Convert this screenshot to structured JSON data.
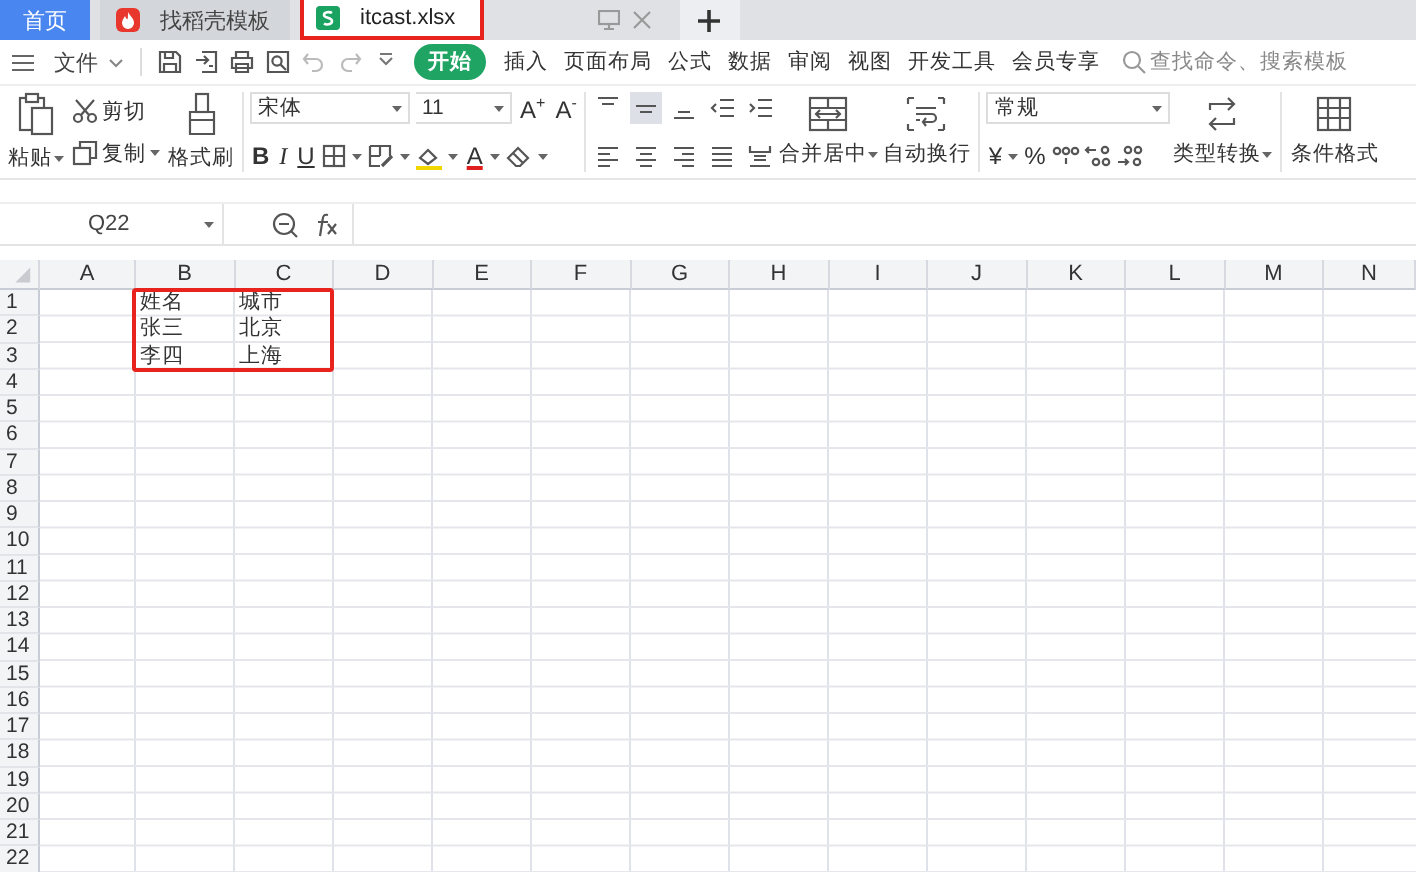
{
  "tabs": [
    {
      "label": "首页",
      "kind": "home",
      "selected": false,
      "highlighted": false
    },
    {
      "label": "找稻壳模板",
      "kind": "template",
      "selected": false,
      "highlighted": false
    },
    {
      "label": "itcast.xlsx",
      "kind": "sheet",
      "selected": true,
      "highlighted": true
    }
  ],
  "file_menu": {
    "label": "文件"
  },
  "menu_tabs": [
    {
      "label": "开始",
      "selected": true
    },
    {
      "label": "插入",
      "selected": false
    },
    {
      "label": "页面布局",
      "selected": false
    },
    {
      "label": "公式",
      "selected": false
    },
    {
      "label": "数据",
      "selected": false
    },
    {
      "label": "审阅",
      "selected": false
    },
    {
      "label": "视图",
      "selected": false
    },
    {
      "label": "开发工具",
      "selected": false
    },
    {
      "label": "会员专享",
      "selected": false
    }
  ],
  "search": {
    "placeholder": "查找命令、搜索模板"
  },
  "ribbon": {
    "clipboard": [
      {
        "kind": "paste",
        "label": "粘贴",
        "dropdown": true
      },
      {
        "kind": "cut",
        "label": "剪切",
        "dropdown": false
      },
      {
        "kind": "copy",
        "label": "复制",
        "dropdown": true
      },
      {
        "kind": "format_painter",
        "label": "格式刷",
        "dropdown": false
      }
    ],
    "font": {
      "name": "宋体",
      "size": "11",
      "size_buttons": [
        "A$^{+}$",
        "A$^{-}$"
      ],
      "style_buttons": [
        "B",
        "I",
        "U"
      ],
      "font_color_label": "A"
    },
    "align_buttons": [
      {
        "kind": "top",
        "selected": false
      },
      {
        "kind": "middle",
        "selected": true
      },
      {
        "kind": "bottom",
        "selected": false
      },
      {
        "kind": "outdent",
        "selected": false
      },
      {
        "kind": "indent",
        "selected": false
      },
      {
        "kind": "left",
        "selected": false
      },
      {
        "kind": "center",
        "selected": false
      },
      {
        "kind": "right",
        "selected": false
      },
      {
        "kind": "justify",
        "selected": false
      },
      {
        "kind": "distributed",
        "selected": false
      }
    ],
    "alignment": [
      {
        "kind": "merge_center",
        "label": "合并居中",
        "dropdown": true
      },
      {
        "kind": "wrap_text",
        "label": "自动换行",
        "dropdown": false
      }
    ],
    "number": {
      "format": "常规",
      "symbols": [
        "¥",
        "%"
      ],
      "convert": {
        "label": "类型转换",
        "dropdown": true
      }
    },
    "conditional_format": {
      "label": "条件格式"
    }
  },
  "formula_bar": {
    "name_box": "Q22"
  },
  "sheet": {
    "columns": [
      "A",
      "B",
      "C",
      "D",
      "E",
      "F",
      "G",
      "H",
      "I",
      "J",
      "K",
      "L",
      "M",
      "N"
    ],
    "rows": [
      {
        "label": "1",
        "framed": true,
        "cells": {
          "B": "姓名",
          "C": "城市"
        }
      },
      {
        "label": "2",
        "framed": true,
        "cells": {
          "B": "张三",
          "C": "北京"
        }
      },
      {
        "label": "3",
        "framed": true,
        "cells": {
          "B": "李四",
          "C": "上海"
        }
      },
      {
        "label": "4",
        "framed": false
      },
      {
        "label": "5",
        "framed": false
      },
      {
        "label": "6",
        "framed": false
      },
      {
        "label": "7",
        "framed": false
      },
      {
        "label": "8",
        "framed": false
      },
      {
        "label": "9",
        "framed": false
      },
      {
        "label": "10",
        "framed": false
      },
      {
        "label": "11",
        "framed": false
      },
      {
        "label": "12",
        "framed": false
      },
      {
        "label": "13",
        "framed": false
      },
      {
        "label": "14",
        "framed": false
      },
      {
        "label": "15",
        "framed": false
      },
      {
        "label": "16",
        "framed": false
      },
      {
        "label": "17",
        "framed": false
      },
      {
        "label": "18",
        "framed": false
      },
      {
        "label": "19",
        "framed": false
      },
      {
        "label": "20",
        "framed": false
      },
      {
        "label": "21",
        "framed": false
      },
      {
        "label": "22",
        "framed": false
      }
    ]
  }
}
